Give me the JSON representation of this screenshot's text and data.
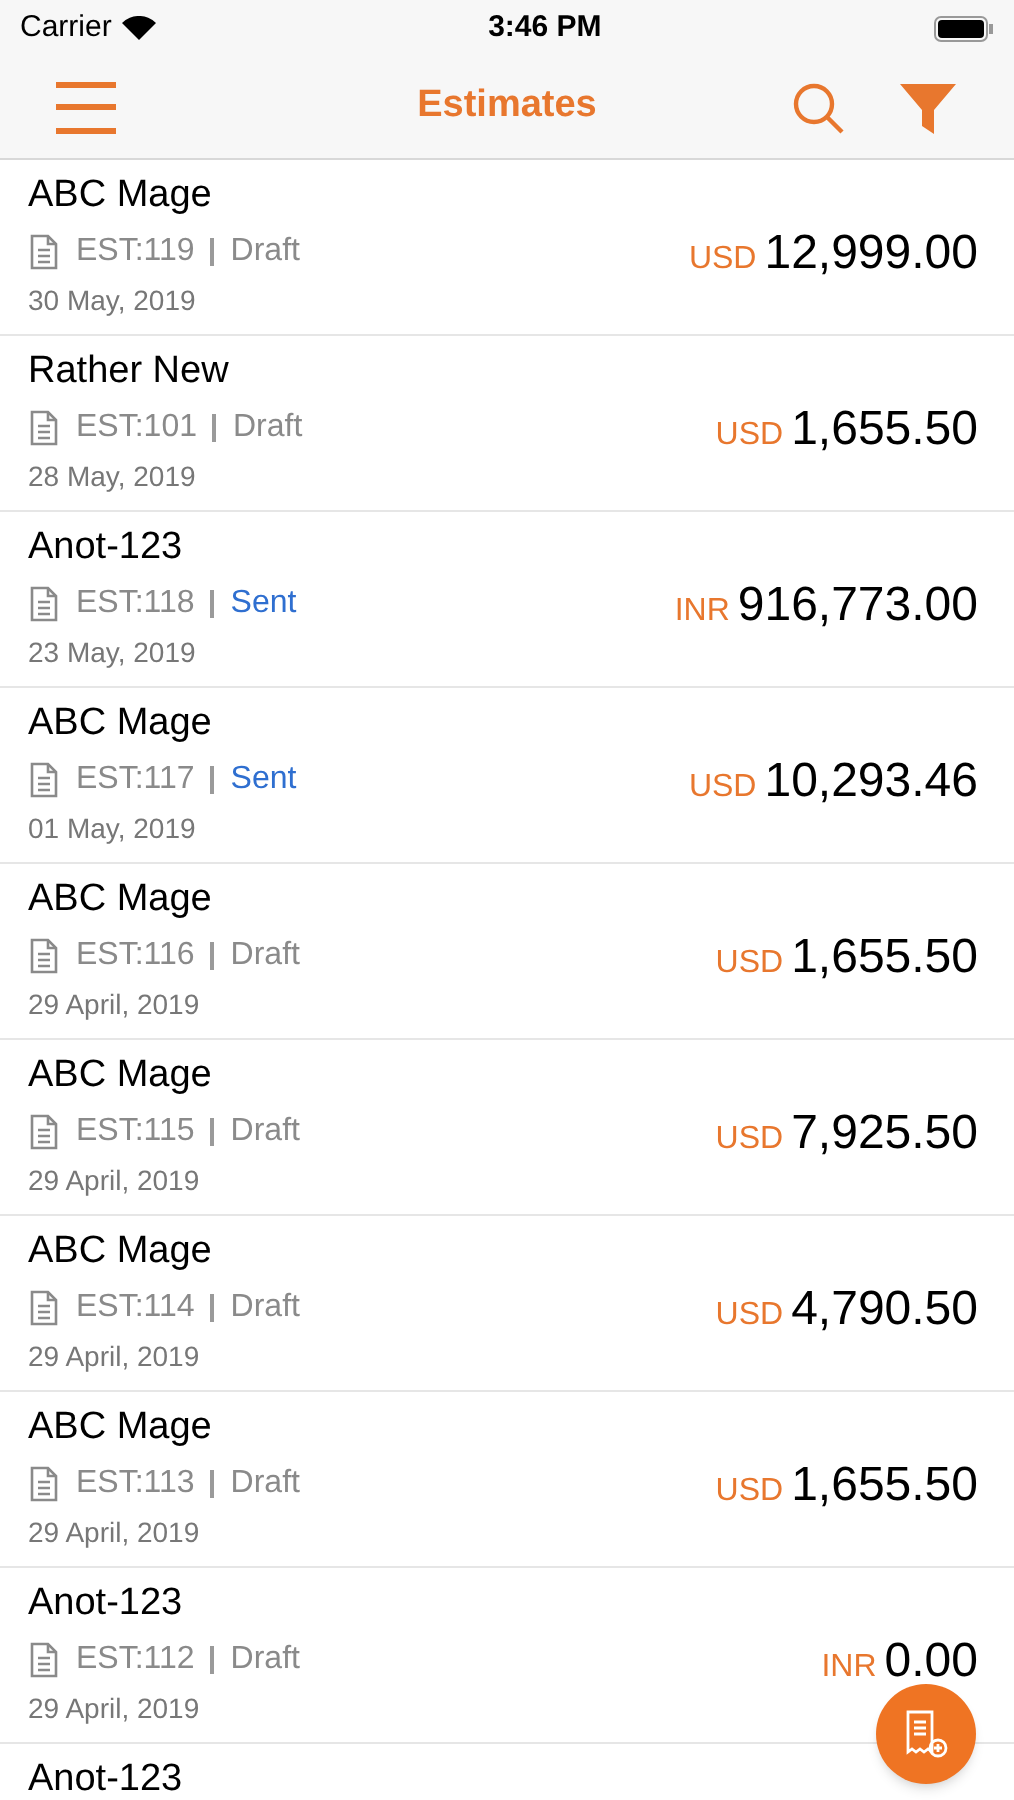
{
  "status_bar": {
    "carrier": "Carrier",
    "time": "3:46 PM"
  },
  "nav": {
    "title": "Estimates"
  },
  "estimates": [
    {
      "name": "ABC Mage",
      "number": "EST:119",
      "status": "Draft",
      "kind": "draft",
      "date": "30 May, 2019",
      "currency": "USD",
      "amount": "12,999.00"
    },
    {
      "name": "Rather New",
      "number": "EST:101",
      "status": "Draft",
      "kind": "draft",
      "date": "28 May, 2019",
      "currency": "USD",
      "amount": "1,655.50"
    },
    {
      "name": "Anot-123",
      "number": "EST:118",
      "status": "Sent",
      "kind": "sent",
      "date": "23 May, 2019",
      "currency": "INR",
      "amount": "916,773.00"
    },
    {
      "name": "ABC Mage",
      "number": "EST:117",
      "status": "Sent",
      "kind": "sent",
      "date": "01 May, 2019",
      "currency": "USD",
      "amount": "10,293.46"
    },
    {
      "name": "ABC Mage",
      "number": "EST:116",
      "status": "Draft",
      "kind": "draft",
      "date": "29 April, 2019",
      "currency": "USD",
      "amount": "1,655.50"
    },
    {
      "name": "ABC Mage",
      "number": "EST:115",
      "status": "Draft",
      "kind": "draft",
      "date": "29 April, 2019",
      "currency": "USD",
      "amount": "7,925.50"
    },
    {
      "name": "ABC Mage",
      "number": "EST:114",
      "status": "Draft",
      "kind": "draft",
      "date": "29 April, 2019",
      "currency": "USD",
      "amount": "4,790.50"
    },
    {
      "name": "ABC Mage",
      "number": "EST:113",
      "status": "Draft",
      "kind": "draft",
      "date": "29 April, 2019",
      "currency": "USD",
      "amount": "1,655.50"
    },
    {
      "name": "Anot-123",
      "number": "EST:112",
      "status": "Draft",
      "kind": "draft",
      "date": "29 April, 2019",
      "currency": "INR",
      "amount": "0.00"
    },
    {
      "name": "Anot-123",
      "kind": "partial"
    }
  ]
}
